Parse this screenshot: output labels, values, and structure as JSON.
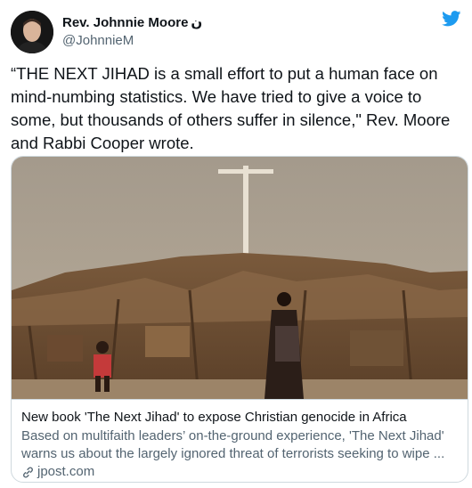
{
  "tweet": {
    "author": {
      "display_name": "Rev. Johnnie Moore",
      "name_suffix": "ن",
      "handle": "@JohnnieM"
    },
    "text": "“THE NEXT JIHAD is a small effort to put a human face on mind-numbing statistics. We have tried to give a voice to some, but thousands of others suffer in silence,\" Rev. Moore and Rabbi Cooper wrote."
  },
  "card": {
    "title": "New book 'The Next Jihad' to expose Christian genocide in Africa",
    "description": "Based on multifaith leaders’ on-the-ground experience, 'The Next Jihad' warns us about the largely ignored threat of terrorists seeking to wipe ...",
    "domain": "jpost.com",
    "link_icon": "link-icon"
  },
  "icons": {
    "brand": "twitter-bird-icon"
  },
  "colors": {
    "twitter_blue": "#1d9bf0",
    "text_primary": "#0f1419",
    "text_secondary": "#536471",
    "border": "#cfd9de"
  }
}
